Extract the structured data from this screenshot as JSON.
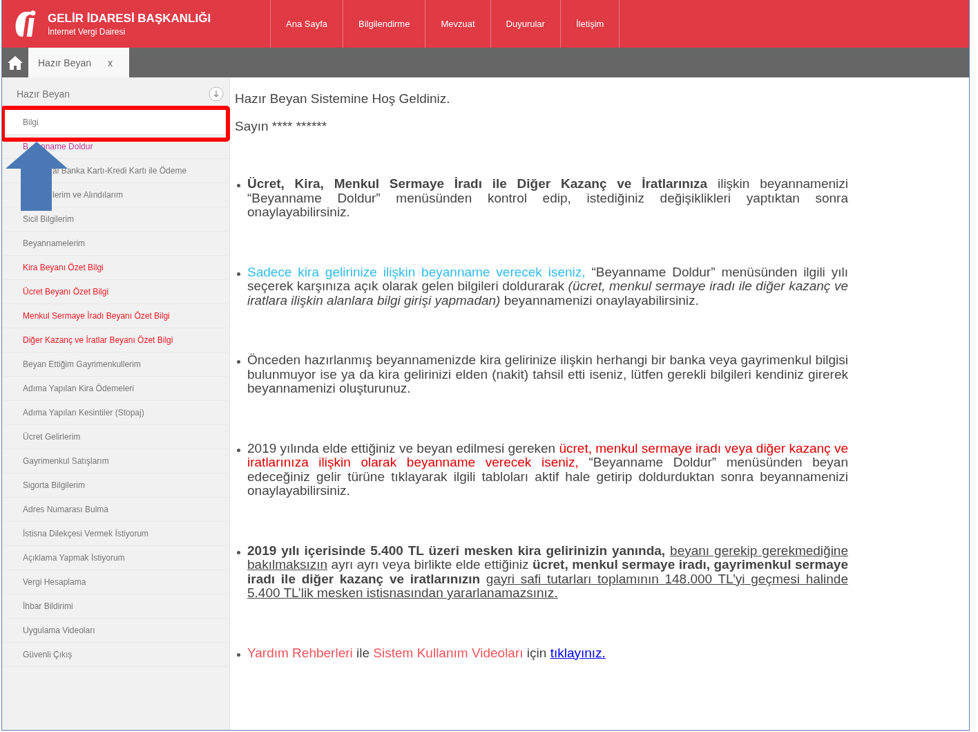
{
  "header": {
    "title": "GELİR İDARESİ BAŞKANLIĞI",
    "subtitle": "İnternet Vergi Dairesi",
    "nav": [
      "Ana Sayfa",
      "Bilgilendirme",
      "Mevzuat",
      "Duyurular",
      "İletişim"
    ]
  },
  "tabs": [
    {
      "label": "Hazır Beyan",
      "close": "x",
      "selected": true
    }
  ],
  "sidebar": {
    "title": "Hazır Beyan",
    "items": [
      {
        "label": "Bilgi",
        "color": "#777777",
        "selected": true
      },
      {
        "kind": "covered",
        "head": "B",
        "label": "nname Doldur",
        "color": "#c0399a",
        "selected": false
      },
      {
        "kind": "covered",
        "label": "al Banka Kartı-Kredi Kartı ile Ödeme",
        "color": "#777777",
        "selected": false
      },
      {
        "kind": "covered",
        "label": "lerim ve Alındılarım",
        "color": "#777777",
        "selected": false
      },
      {
        "label": "Sicil Bilgilerim",
        "color": "#777777",
        "selected": false
      },
      {
        "label": "Beyannamelerim",
        "color": "#777777",
        "selected": false
      },
      {
        "label": "Kira Beyanı Özet Bilgi",
        "color": "#ee1c25",
        "selected": false
      },
      {
        "label": "Ücret Beyanı Özet Bilgi",
        "color": "#ee1c25",
        "selected": false
      },
      {
        "label": "Menkul Sermaye İradı Beyanı Özet Bilgi",
        "color": "#ee1c25",
        "selected": false
      },
      {
        "label": "Diğer Kazanç ve İratlar Beyanı Özet Bilgi",
        "color": "#ee1c25",
        "selected": false
      },
      {
        "label": "Beyan Ettiğim Gayrimenkullerim",
        "color": "#777777",
        "selected": false
      },
      {
        "label": "Adıma Yapılan Kira Ödemeleri",
        "color": "#777777",
        "selected": false
      },
      {
        "label": "Adıma Yapılan Kesintiler (Stopaj)",
        "color": "#777777",
        "selected": false
      },
      {
        "label": "Ücret Gelirlerim",
        "color": "#777777",
        "selected": false
      },
      {
        "label": "Gayrimenkul Satışlarım",
        "color": "#777777",
        "selected": false
      },
      {
        "label": "Sigorta Bilgilerim",
        "color": "#777777",
        "selected": false
      },
      {
        "label": "Adres Numarası Bulma",
        "color": "#777777",
        "selected": false
      },
      {
        "label": "İstisna Dilekçesi Vermek İstiyorum",
        "color": "#777777",
        "selected": false
      },
      {
        "label": "Açıklama Yapmak İstiyorum",
        "color": "#777777",
        "selected": false
      },
      {
        "label": "Vergi Hesaplama",
        "color": "#777777",
        "selected": false
      },
      {
        "label": "İhbar Bildirimi",
        "color": "#777777",
        "selected": false
      },
      {
        "label": "Uygulama Videoları",
        "color": "#777777",
        "selected": false
      },
      {
        "label": "Güvenli Çıkış",
        "color": "#777777",
        "selected": false
      }
    ]
  },
  "content": {
    "heading": "Hazır Beyan Sistemine Hoş Geldiniz.",
    "greeting": "Sayın **** ******",
    "bullets": [
      [
        {
          "kind": "bold",
          "text": "Ücret, Kira, Menkul Sermaye İradı ile Diğer Kazanç ve İratlarınıza"
        },
        {
          "kind": "plain",
          "text": " ilişkin beyannamenizi “Beyanname Doldur” menüsünden kontrol edip, istediğiniz değişiklikleri yaptıktan sonra onaylayabilirsiniz."
        }
      ],
      [
        {
          "kind": "cyan",
          "text": "Sadece kira gelirinize ilişkin beyanname verecek iseniz,"
        },
        {
          "kind": "plain",
          "text": " “Beyanname Doldur” menüsünden ilgili yılı seçerek karşınıza açık olarak gelen bilgileri doldurarak "
        },
        {
          "kind": "italic",
          "text": "(ücret, menkul sermaye iradı ile diğer kazanç ve iratlara ilişkin alanlara bilgi girişi yapmadan)"
        },
        {
          "kind": "plain",
          "text": " beyannamenizi onaylayabilirsiniz."
        }
      ],
      [
        {
          "kind": "plain",
          "text": "Önceden hazırlanmış beyannamenizde kira gelirinize ilişkin herhangi bir banka veya gayrimenkul bilgisi bulunmuyor ise ya da kira gelirinizi elden (nakit) tahsil etti iseniz, lütfen gerekli bilgileri kendiniz girerek beyannamenizi oluşturunuz."
        }
      ],
      [
        {
          "kind": "plain",
          "text": "2019 yılında elde ettiğiniz ve beyan edilmesi gereken "
        },
        {
          "kind": "red",
          "text": "ücret, menkul sermaye iradı veya diğer kazanç ve iratlarınıza ilişkin olarak beyanname verecek iseniz,"
        },
        {
          "kind": "plain",
          "text": " “Beyanname Doldur” menüsünden beyan edeceğiniz gelir türüne tıklayarak ilgili tabloları aktif hale getirip doldurduktan sonra beyannamenizi onaylayabilirsiniz."
        }
      ],
      [
        {
          "kind": "bold",
          "text": "2019 yılı içerisinde 5.400 TL üzeri mesken kira gelirinizin yanında, "
        },
        {
          "kind": "underline",
          "text": "beyanı gerekip gerekmediğine bakılmaksızın"
        },
        {
          "kind": "plain",
          "text": " ayrı ayrı veya birlikte elde ettiğiniz "
        },
        {
          "kind": "bold",
          "text": "ücret, menkul sermaye iradı, gayrimenkul sermaye iradı ile diğer kazanç ve iratlarınızın "
        },
        {
          "kind": "underline",
          "text": "gayri safi tutarları toplamının 148.000 TL’yi geçmesi halinde 5.400 TL’lik mesken istisnasından yararlanamazsınız."
        }
      ],
      [
        {
          "kind": "salmon",
          "text": "Yardım Rehberleri"
        },
        {
          "kind": "plain",
          "text": " ile "
        },
        {
          "kind": "salmon",
          "text": "Sistem Kullanım Videoları"
        },
        {
          "kind": "plain",
          "text": " için "
        },
        {
          "kind": "link",
          "text": "tıklayınız."
        }
      ]
    ]
  }
}
